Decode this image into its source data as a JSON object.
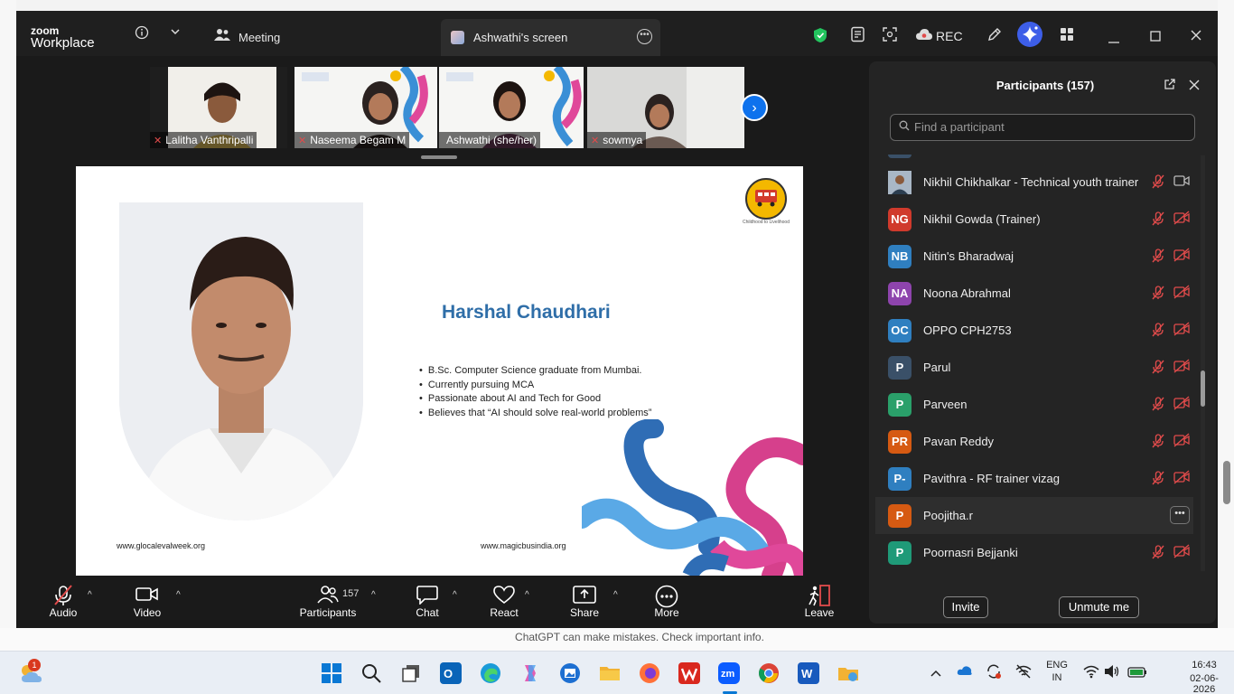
{
  "window": {
    "logo_line1": "zoom",
    "logo_line2": "Workplace",
    "meeting_tab": "Meeting",
    "share_tab": "Ashwathi's screen",
    "rec_label": "REC"
  },
  "thumbnails": [
    {
      "name": "Lalitha Vanthripalli"
    },
    {
      "name": "Naseema Begam M"
    },
    {
      "name": "Ashwathi (she/her)"
    },
    {
      "name": "sowmya"
    }
  ],
  "slide": {
    "title": "Harshal Chaudhari",
    "bullets": [
      "B.Sc. Computer Science graduate from Mumbai.",
      "Currently pursuing MCA",
      "Passionate about AI and Tech for Good",
      "Believes that “AI should solve real-world problems”"
    ],
    "footer_left": "www.glocalevalweek.org",
    "footer_right": "www.magicbusindia.org",
    "badge_label": "Magic Bus",
    "badge_tagline": "Childhood to Livelihood"
  },
  "toolbar": {
    "audio": "Audio",
    "video": "Video",
    "participants": "Participants",
    "participants_count": "157",
    "chat": "Chat",
    "react": "React",
    "share": "Share",
    "more": "More",
    "leave": "Leave"
  },
  "panel": {
    "title": "Participants (157)",
    "search_placeholder": "Find a participant",
    "participants": [
      {
        "initials": "",
        "name": "Nikhil Chikhalkar - Technical youth trainer",
        "color": "#6b7b8c",
        "photo": true,
        "video_on": true
      },
      {
        "initials": "NG",
        "name": "Nikhil Gowda (Trainer)",
        "color": "#d03a2c"
      },
      {
        "initials": "NB",
        "name": "Nitin's Bharadwaj",
        "color": "#2f7fc0"
      },
      {
        "initials": "NA",
        "name": "Noona Abrahmal",
        "color": "#8e44ad"
      },
      {
        "initials": "OC",
        "name": "OPPO CPH2753",
        "color": "#2f7fc0"
      },
      {
        "initials": "P",
        "name": "Parul",
        "color": "#3a5068"
      },
      {
        "initials": "P",
        "name": "Parveen",
        "color": "#2aa06a"
      },
      {
        "initials": "PR",
        "name": "Pavan Reddy",
        "color": "#d65a12"
      },
      {
        "initials": "P-",
        "name": "Pavithra - RF trainer vizag",
        "color": "#2f7fc0"
      },
      {
        "initials": "P",
        "name": "Poojitha.r",
        "color": "#d65a12",
        "highlight": true
      },
      {
        "initials": "P",
        "name": "Poornasri Bejjanki",
        "color": "#1f9a78"
      }
    ],
    "invite": "Invite",
    "unmute_me": "Unmute me"
  },
  "browser": {
    "notice": "ChatGPT can make mistakes. Check important info."
  },
  "taskbar": {
    "notification_count": "1",
    "lang_line1": "ENG",
    "lang_line2": "IN",
    "time": "16:43",
    "date": "02-06-2026"
  }
}
